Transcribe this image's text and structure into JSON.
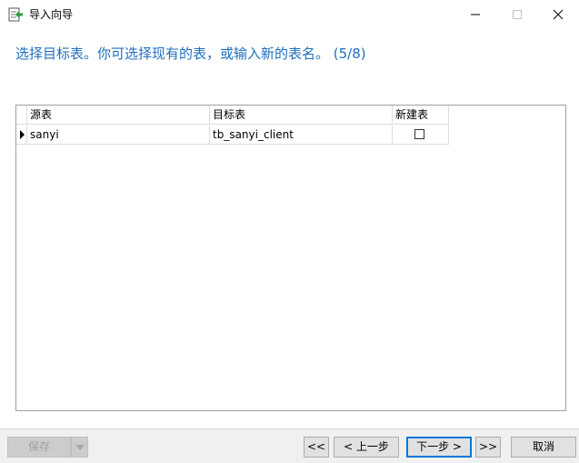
{
  "window": {
    "title": "导入向导",
    "icon": "import-wizard-icon"
  },
  "heading": "选择目标表。你可选择现有的表，或输入新的表名。 (5/8)",
  "grid": {
    "columns": [
      "源表",
      "目标表",
      "新建表"
    ],
    "rows": [
      {
        "source": "sanyi",
        "target": "tb_sanyi_client",
        "create_new": false
      }
    ]
  },
  "footer": {
    "save_label": "保存",
    "first_label": "<<",
    "prev_label": "< 上一步",
    "next_label": "下一步 >",
    "last_label": ">>",
    "cancel_label": "取消"
  },
  "colors": {
    "heading": "#1f6fbf",
    "focus_border": "#0078d7",
    "footer_bg": "#f0f0f0"
  }
}
